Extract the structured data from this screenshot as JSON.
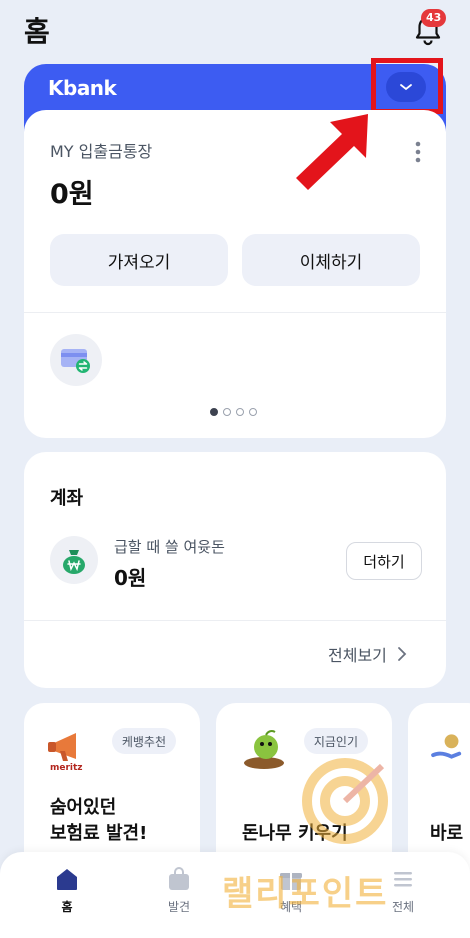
{
  "header": {
    "title": "홈",
    "notification_count": "43"
  },
  "kbank_card": {
    "brand": "Kbank",
    "account_name": "MY 입출금통장",
    "balance": "0원",
    "buttons": {
      "fetch": "가져오기",
      "transfer": "이체하기"
    },
    "page_indicator": {
      "total": 4,
      "active": 1
    }
  },
  "accounts": {
    "title": "계좌",
    "items": [
      {
        "label": "급할 때 쓸 여윳돈",
        "balance": "0원",
        "action": "더하기"
      }
    ],
    "view_all": "전체보기"
  },
  "promos": [
    {
      "tag": "케뱅추천",
      "title": "숨어있던\n보험료 발견!",
      "brand_text": "meritz"
    },
    {
      "tag": "지금인기",
      "title": "돈나무 키우기"
    },
    {
      "tag": "",
      "title": "바로"
    }
  ],
  "watermark": {
    "text": "랠리포인트"
  },
  "nav": {
    "items": [
      {
        "label": "홈",
        "icon": "home-icon",
        "active": true
      },
      {
        "label": "발견",
        "icon": "bag-icon",
        "active": false
      },
      {
        "label": "혜택",
        "icon": "gift-icon",
        "active": false
      },
      {
        "label": "전체",
        "icon": "menu-icon",
        "active": false
      }
    ]
  },
  "colors": {
    "brand_blue": "#3d5cf2",
    "highlight_red": "#e3141b",
    "badge_red": "#e5383b",
    "background": "#e9eef7"
  }
}
